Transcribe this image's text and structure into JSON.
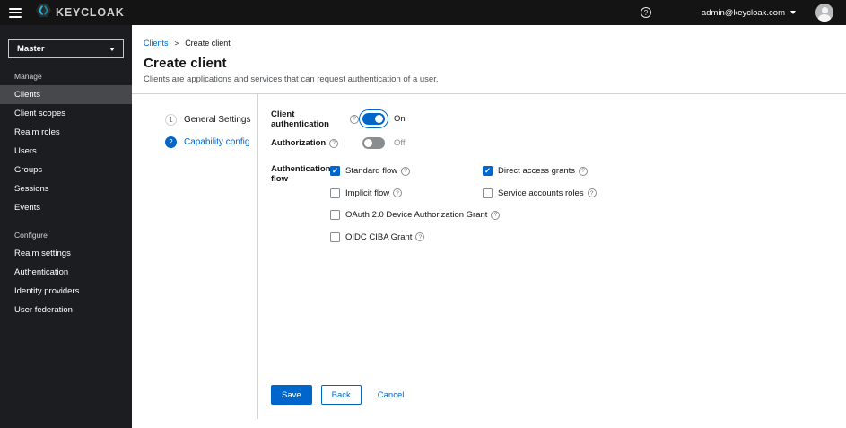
{
  "colors": {
    "primary": "#0066cc",
    "link": "#0066cc",
    "header_bg": "#141414",
    "sidebar_bg": "#1b1d21",
    "sidebar_selected_bg": "#46484c",
    "border": "#d2d2d2",
    "toggle_off": "#8a8d90",
    "text": "#151515",
    "muted": "#6a6e73"
  },
  "icons": {
    "hamburger": "three-bars",
    "brand_logo": "keycloak-mark",
    "help": "question-circle",
    "caret_down": "triangle-down",
    "avatar": "person-silhouette",
    "breadcrumb_separator": ">",
    "field_help": "question-circle",
    "checkbox_check": "check-mark"
  },
  "header": {
    "brand": "KEYCLOAK",
    "username": "admin@keycloak.com"
  },
  "sidebar": {
    "realm_selector": {
      "value": "Master"
    },
    "sections": [
      {
        "label": "Manage",
        "items": [
          {
            "label": "Clients",
            "selected": true
          },
          {
            "label": "Client scopes",
            "selected": false
          },
          {
            "label": "Realm roles",
            "selected": false
          },
          {
            "label": "Users",
            "selected": false
          },
          {
            "label": "Groups",
            "selected": false
          },
          {
            "label": "Sessions",
            "selected": false
          },
          {
            "label": "Events",
            "selected": false
          }
        ]
      },
      {
        "label": "Configure",
        "items": [
          {
            "label": "Realm settings",
            "selected": false
          },
          {
            "label": "Authentication",
            "selected": false
          },
          {
            "label": "Identity providers",
            "selected": false
          },
          {
            "label": "User federation",
            "selected": false
          }
        ]
      }
    ]
  },
  "breadcrumb": {
    "items": [
      {
        "label": "Clients",
        "current": false
      },
      {
        "label": "Create client",
        "current": true
      }
    ]
  },
  "page": {
    "title": "Create client",
    "subtitle": "Clients are applications and services that can request authentication of a user."
  },
  "wizard": {
    "steps": [
      {
        "number": "1",
        "label": "General Settings",
        "active": false
      },
      {
        "number": "2",
        "label": "Capability config",
        "active": true
      }
    ]
  },
  "form": {
    "client_auth": {
      "label": "Client authentication",
      "checked": true,
      "state_label": "On"
    },
    "authorization": {
      "label": "Authorization",
      "checked": false,
      "state_label": "Off"
    },
    "auth_flow": {
      "label": "Authentication flow",
      "options": [
        {
          "label": "Standard flow",
          "checked": true
        },
        {
          "label": "Direct access grants",
          "checked": true
        },
        {
          "label": "Implicit flow",
          "checked": false
        },
        {
          "label": "Service accounts roles",
          "checked": false
        },
        {
          "label": "OAuth 2.0 Device Authorization Grant",
          "checked": false
        },
        {
          "label": "OIDC CIBA Grant",
          "checked": false
        }
      ]
    },
    "buttons": {
      "save": "Save",
      "back": "Back",
      "cancel": "Cancel"
    }
  }
}
